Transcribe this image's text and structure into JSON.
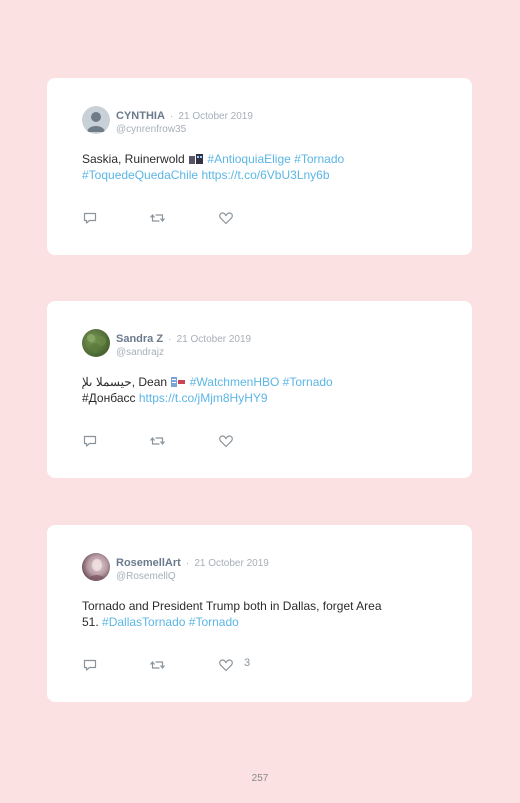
{
  "page": {
    "page_number": "257"
  },
  "tweets": [
    {
      "name": "CYNTHIA",
      "date_separator": "·",
      "date": "21 October 2019",
      "handle": "@cynrenfrow35",
      "text_prefix": "Saskia, Ruinerwold",
      "hashtags_line1": [
        "#AntioquiaElige",
        "#Tornado"
      ],
      "hashtags_line2": [
        "#ToquedeQuedaChile"
      ],
      "link": "https://t.co/6VbU3Lny6b",
      "likes": ""
    },
    {
      "name": "Sandra Z",
      "date_separator": "·",
      "date": "21 October 2019",
      "handle": "@sandrajz",
      "text_prefix": "حيسملا ىلإ, Dean",
      "hashtags_line1": [
        "#WatchmenHBO",
        "#Tornado"
      ],
      "line2_prefix": "#Донбасс",
      "link": "https://t.co/jMjm8HyHY9",
      "likes": ""
    },
    {
      "name": "RosemellArt",
      "date_separator": "·",
      "date": "21 October 2019",
      "handle": "@RosemellQ",
      "text_line1": "Tornado and President Trump both in Dallas, forget Area",
      "text_line2_prefix": "51.",
      "hashtags_line2": [
        "#DallasTornado",
        "#Tornado"
      ],
      "likes": "3"
    }
  ],
  "icons": {
    "reply": "speech-bubble-icon",
    "retweet": "retweet-arrows-icon",
    "like": "heart-icon"
  },
  "colors": {
    "background": "#fbe1e2",
    "card": "#ffffff",
    "link": "#5bb6e6",
    "name": "#6a7a8c",
    "muted": "#a7afb8"
  }
}
